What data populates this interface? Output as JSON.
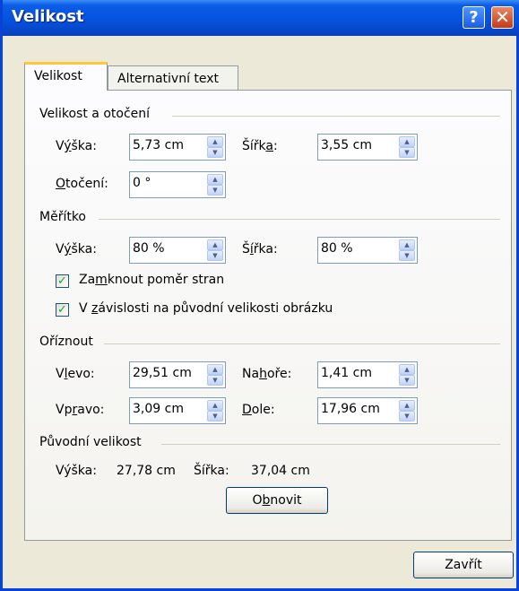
{
  "window": {
    "title": "Velikost"
  },
  "titlebar": {
    "help_label": "?",
    "close_label": "✕"
  },
  "tabs": [
    {
      "label": "Velikost",
      "active": true
    },
    {
      "label": "Alternativní text",
      "active": false
    }
  ],
  "size_rotation": {
    "heading": "Velikost a otočení",
    "height_label_pre": "V",
    "height_label_u": "ý",
    "height_label_post": "ška:",
    "height_value": "5,73 cm",
    "width_label_pre": "Šířk",
    "width_label_u": "a",
    "width_label_post": ":",
    "width_value": "3,55 cm",
    "rotation_label_pre": "",
    "rotation_label_u": "O",
    "rotation_label_post": "točení:",
    "rotation_value": "0 °"
  },
  "scale": {
    "heading": "Měřítko",
    "height_label_pre": "V",
    "height_label_u": "ý",
    "height_label_post": "ška:",
    "height_value": "80 %",
    "width_label_pre": "Š",
    "width_label_u": "í",
    "width_label_post": "řka:",
    "width_value": "80 %",
    "lock_pre": "Za",
    "lock_u": "m",
    "lock_post": "knout poměr stran",
    "lock_checked": true,
    "relative_pre": "V ",
    "relative_u": "z",
    "relative_post": "ávislosti na původní velikosti obrázku",
    "relative_checked": true
  },
  "crop": {
    "heading": "Oříznout",
    "left_label_pre": "V",
    "left_label_u": "l",
    "left_label_post": "evo:",
    "left_value": "29,51 cm",
    "top_label_pre": "Na",
    "top_label_u": "h",
    "top_label_post": "oře:",
    "top_value": "1,41 cm",
    "right_label_pre": "Vp",
    "right_label_u": "r",
    "right_label_post": "avo:",
    "right_value": "3,09 cm",
    "bottom_label_pre": "",
    "bottom_label_u": "D",
    "bottom_label_post": "ole:",
    "bottom_value": "17,96 cm"
  },
  "original": {
    "heading": "Původní velikost",
    "height_label": "Výška:",
    "height_value": "27,78 cm",
    "width_label": "Šířka:",
    "width_value": "37,04 cm",
    "reset_pre": "O",
    "reset_u": "b",
    "reset_post": "novit"
  },
  "footer": {
    "close_label": "Zavřít"
  }
}
